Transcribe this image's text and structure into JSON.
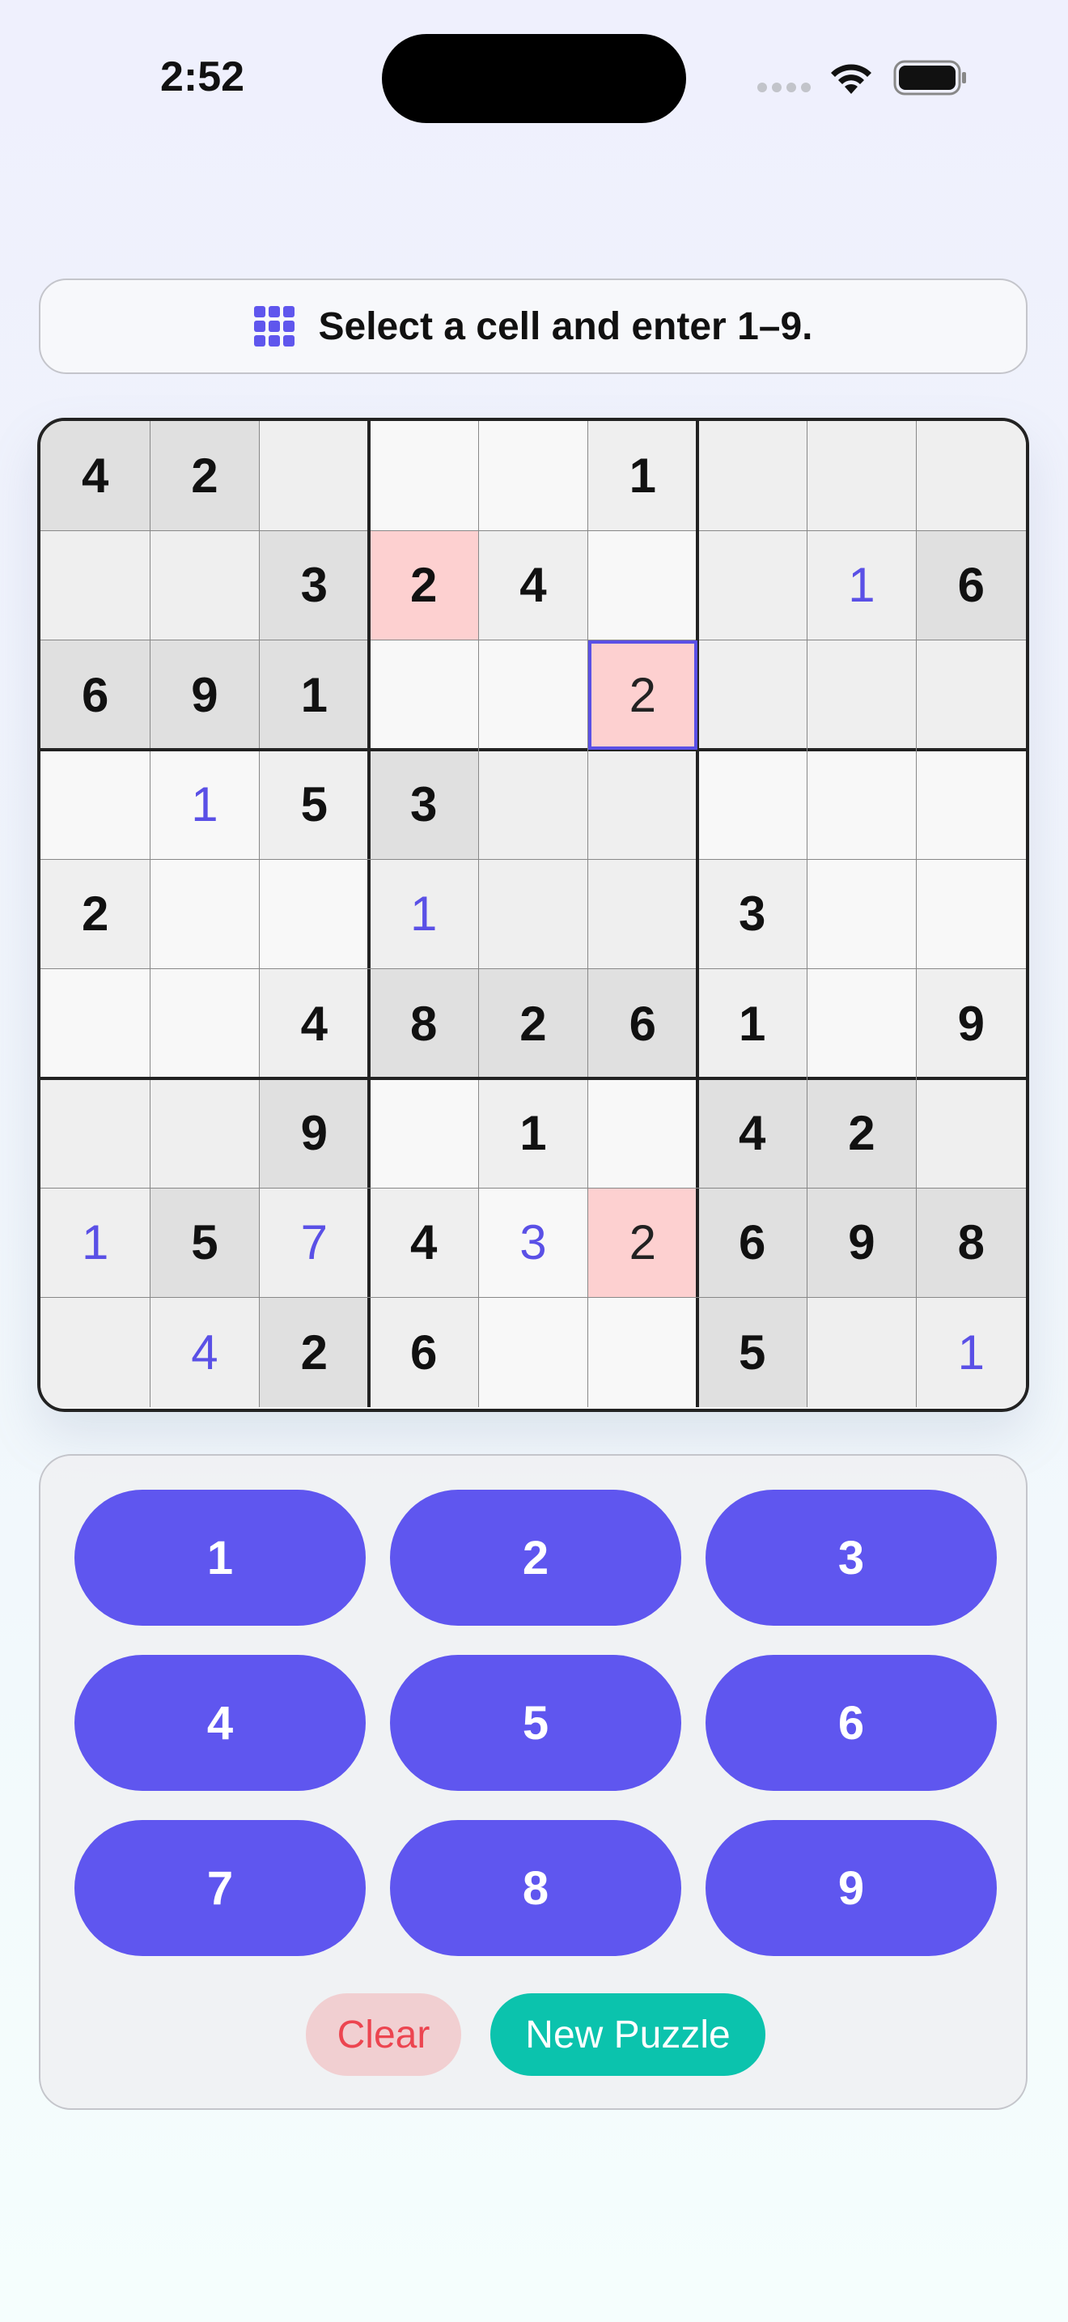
{
  "status_bar": {
    "time": "2:52"
  },
  "hint": {
    "icon": "grid-icon",
    "text": "Select a cell and enter 1–9."
  },
  "colors": {
    "accent": "#5f56ef",
    "error_bg": "#fdd0d0",
    "given_bg": "#e0e0e0",
    "light_bg": "#efefef",
    "user_digit": "#5a50e6",
    "clear_bg": "#f1cfd1",
    "clear_text": "#ec4550",
    "new_puzzle_bg": "#0bc3ad"
  },
  "board": {
    "selected": [
      2,
      5
    ],
    "cells": [
      [
        {
          "v": "4",
          "t": "given",
          "bg": "given"
        },
        {
          "v": "2",
          "t": "given",
          "bg": "given"
        },
        {
          "v": "",
          "bg": "light"
        },
        {
          "v": "",
          "bg": "white"
        },
        {
          "v": "",
          "bg": "white"
        },
        {
          "v": "1",
          "t": "given",
          "bg": "light"
        },
        {
          "v": "",
          "bg": "light"
        },
        {
          "v": "",
          "bg": "light"
        },
        {
          "v": "",
          "bg": "light"
        }
      ],
      [
        {
          "v": "",
          "bg": "light"
        },
        {
          "v": "",
          "bg": "light"
        },
        {
          "v": "3",
          "t": "given",
          "bg": "given"
        },
        {
          "v": "2",
          "t": "given",
          "bg": "error"
        },
        {
          "v": "4",
          "t": "given",
          "bg": "light"
        },
        {
          "v": "",
          "bg": "white"
        },
        {
          "v": "",
          "bg": "light"
        },
        {
          "v": "1",
          "t": "user",
          "bg": "light"
        },
        {
          "v": "6",
          "t": "given",
          "bg": "given"
        }
      ],
      [
        {
          "v": "6",
          "t": "given",
          "bg": "given"
        },
        {
          "v": "9",
          "t": "given",
          "bg": "given"
        },
        {
          "v": "1",
          "t": "given",
          "bg": "given"
        },
        {
          "v": "",
          "bg": "white"
        },
        {
          "v": "",
          "bg": "white"
        },
        {
          "v": "2",
          "t": "user-err",
          "bg": "error"
        },
        {
          "v": "",
          "bg": "light"
        },
        {
          "v": "",
          "bg": "light"
        },
        {
          "v": "",
          "bg": "light"
        }
      ],
      [
        {
          "v": "",
          "bg": "white"
        },
        {
          "v": "1",
          "t": "user",
          "bg": "white"
        },
        {
          "v": "5",
          "t": "given",
          "bg": "light"
        },
        {
          "v": "3",
          "t": "given",
          "bg": "given"
        },
        {
          "v": "",
          "bg": "light"
        },
        {
          "v": "",
          "bg": "light"
        },
        {
          "v": "",
          "bg": "white"
        },
        {
          "v": "",
          "bg": "white"
        },
        {
          "v": "",
          "bg": "white"
        }
      ],
      [
        {
          "v": "2",
          "t": "given",
          "bg": "light"
        },
        {
          "v": "",
          "bg": "white"
        },
        {
          "v": "",
          "bg": "white"
        },
        {
          "v": "1",
          "t": "user",
          "bg": "light"
        },
        {
          "v": "",
          "bg": "light"
        },
        {
          "v": "",
          "bg": "light"
        },
        {
          "v": "3",
          "t": "given",
          "bg": "light"
        },
        {
          "v": "",
          "bg": "white"
        },
        {
          "v": "",
          "bg": "white"
        }
      ],
      [
        {
          "v": "",
          "bg": "white"
        },
        {
          "v": "",
          "bg": "white"
        },
        {
          "v": "4",
          "t": "given",
          "bg": "light"
        },
        {
          "v": "8",
          "t": "given",
          "bg": "given"
        },
        {
          "v": "2",
          "t": "given",
          "bg": "given"
        },
        {
          "v": "6",
          "t": "given",
          "bg": "given"
        },
        {
          "v": "1",
          "t": "given",
          "bg": "light"
        },
        {
          "v": "",
          "bg": "white"
        },
        {
          "v": "9",
          "t": "given",
          "bg": "light"
        }
      ],
      [
        {
          "v": "",
          "bg": "light"
        },
        {
          "v": "",
          "bg": "light"
        },
        {
          "v": "9",
          "t": "given",
          "bg": "given"
        },
        {
          "v": "",
          "bg": "white"
        },
        {
          "v": "1",
          "t": "given",
          "bg": "light"
        },
        {
          "v": "",
          "bg": "white"
        },
        {
          "v": "4",
          "t": "given",
          "bg": "given"
        },
        {
          "v": "2",
          "t": "given",
          "bg": "given"
        },
        {
          "v": "",
          "bg": "light"
        }
      ],
      [
        {
          "v": "1",
          "t": "user",
          "bg": "light"
        },
        {
          "v": "5",
          "t": "given",
          "bg": "given"
        },
        {
          "v": "7",
          "t": "user",
          "bg": "light"
        },
        {
          "v": "4",
          "t": "given",
          "bg": "light"
        },
        {
          "v": "3",
          "t": "user",
          "bg": "white"
        },
        {
          "v": "2",
          "t": "user-err",
          "bg": "error"
        },
        {
          "v": "6",
          "t": "given",
          "bg": "given"
        },
        {
          "v": "9",
          "t": "given",
          "bg": "given"
        },
        {
          "v": "8",
          "t": "given",
          "bg": "given"
        }
      ],
      [
        {
          "v": "",
          "bg": "light"
        },
        {
          "v": "4",
          "t": "user",
          "bg": "light"
        },
        {
          "v": "2",
          "t": "given",
          "bg": "given"
        },
        {
          "v": "6",
          "t": "given",
          "bg": "light"
        },
        {
          "v": "",
          "bg": "white"
        },
        {
          "v": "",
          "bg": "white"
        },
        {
          "v": "5",
          "t": "given",
          "bg": "given"
        },
        {
          "v": "",
          "bg": "light"
        },
        {
          "v": "1",
          "t": "user",
          "bg": "light"
        }
      ]
    ]
  },
  "keypad": {
    "digits": [
      "1",
      "2",
      "3",
      "4",
      "5",
      "6",
      "7",
      "8",
      "9"
    ],
    "clear_label": "Clear",
    "new_puzzle_label": "New Puzzle"
  }
}
